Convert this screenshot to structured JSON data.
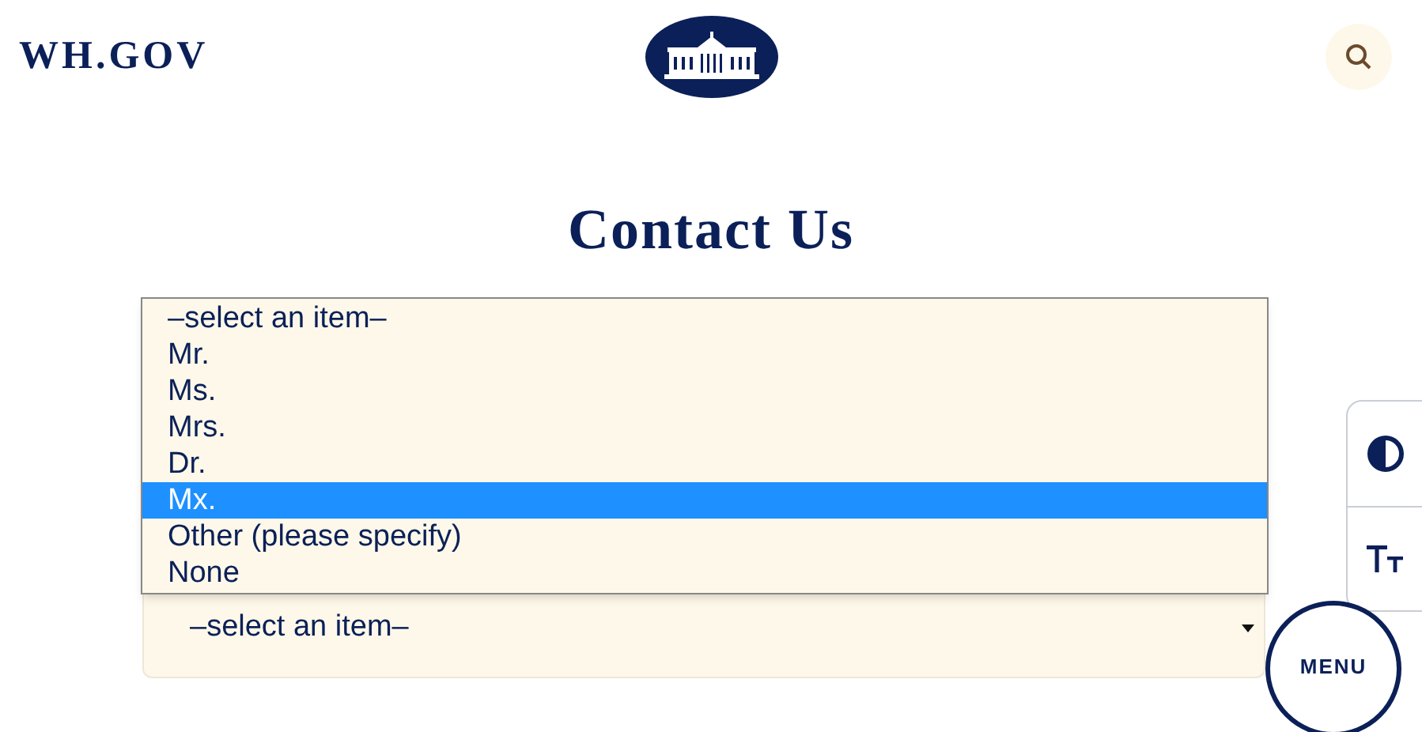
{
  "header": {
    "site_name": "WH.GOV"
  },
  "title": "Contact Us",
  "title_select": {
    "value": "–select an item–",
    "expanded": true,
    "options": [
      {
        "label": "–select an item–",
        "highlighted": false
      },
      {
        "label": "Mr.",
        "highlighted": false
      },
      {
        "label": "Ms.",
        "highlighted": false
      },
      {
        "label": "Mrs.",
        "highlighted": false
      },
      {
        "label": "Dr.",
        "highlighted": false
      },
      {
        "label": "Mx.",
        "highlighted": true
      },
      {
        "label": "Other (please specify)",
        "highlighted": false
      },
      {
        "label": "None",
        "highlighted": false
      }
    ]
  },
  "menu_button": {
    "label": "MENU"
  }
}
